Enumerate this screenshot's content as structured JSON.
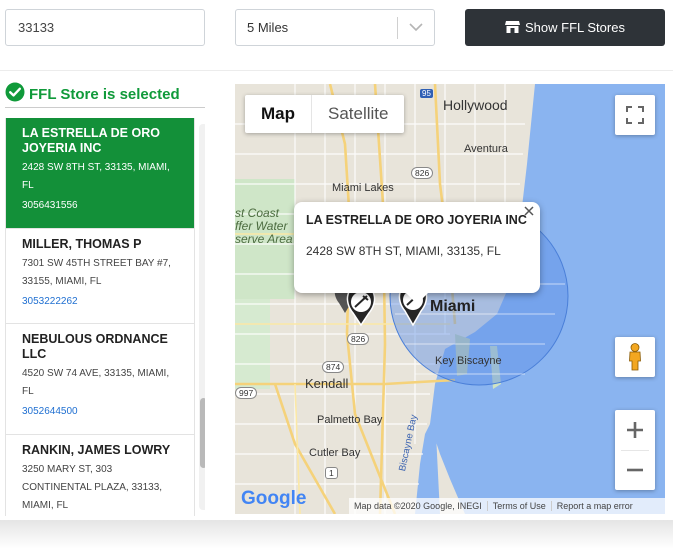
{
  "search": {
    "zip_value": "33133"
  },
  "radius": {
    "selected": "5 Miles"
  },
  "show_button": {
    "label": "Show FFL Stores"
  },
  "selected_banner": {
    "text": "FFL Store is selected"
  },
  "stores": [
    {
      "name": "LA ESTRELLA DE ORO JOYERIA INC",
      "address": "2428 SW 8TH ST, 33135, MIAMI, FL",
      "phone": "3056431556",
      "active": true
    },
    {
      "name": "MILLER, THOMAS P",
      "address": "7301 SW 45TH STREET BAY #7, 33155, MIAMI, FL",
      "phone": "3053222262",
      "active": false
    },
    {
      "name": "NEBULOUS ORDNANCE LLC",
      "address": "4520 SW 74 AVE, 33135, MIAMI, FL",
      "phone": "3052644500",
      "active": false
    },
    {
      "name": "RANKIN, JAMES LOWRY",
      "address": "3250 MARY ST, 303 CONTINENTAL PLAZA, 33133, MIAMI, FL",
      "phone": "",
      "active": false
    }
  ],
  "map": {
    "tabs": {
      "map": "Map",
      "satellite": "Satellite"
    },
    "info_window": {
      "title": "LA ESTRELLA DE ORO JOYERIA INC",
      "address": "2428 SW 8TH ST, MIAMI, 33135, FL"
    },
    "labels": {
      "hollywood": "Hollywood",
      "aventura": "Aventura",
      "miami_lakes": "Miami Lakes",
      "east_coast": "st Coast",
      "buffer_water": "ffer Water",
      "conserve_area": "serve Area",
      "miami": "Miami",
      "key_biscayne": "Key Biscayne",
      "kendall": "Kendall",
      "palmetto_bay": "Palmetto Bay",
      "cutler_bay": "Cutler Bay",
      "biscayne_bay": "Biscayne Bay",
      "hwy_826_a": "826",
      "hwy_826_b": "826",
      "hwy_874": "874",
      "hwy_997": "997",
      "hwy_1": "1",
      "hwy_95": "95"
    },
    "logo": "Google",
    "footer": {
      "data": "Map data ©2020 Google, INEGI",
      "terms": "Terms of Use",
      "report": "Report a map error"
    }
  },
  "colors": {
    "active_green": "#139039",
    "banner_green": "#109a3a",
    "button_dark": "#2e3338",
    "phone_blue": "#1f6fd1",
    "water": "#8ab4f0",
    "radius_fill": "#5b8fe6"
  }
}
